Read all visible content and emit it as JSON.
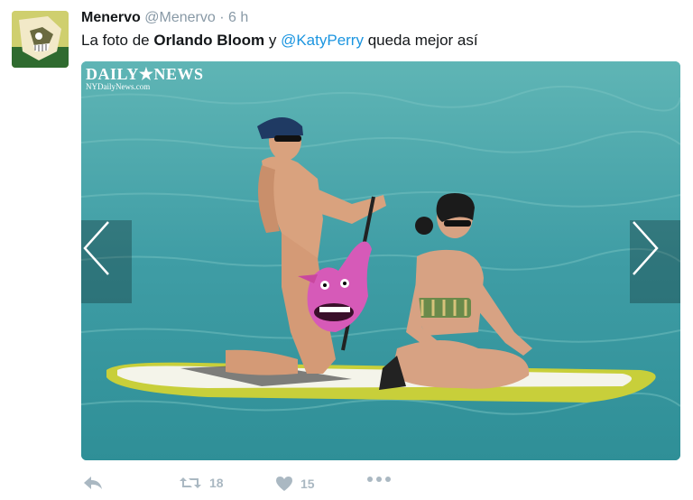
{
  "tweet": {
    "author_name": "Menervo",
    "author_handle": "@Menervo",
    "separator": "·",
    "time": "6 h",
    "text_part1": "La foto de ",
    "text_bold": "Orlando Bloom",
    "text_part2": " y ",
    "text_mention": "@KatyPerry",
    "text_part3": " queda mejor así"
  },
  "media": {
    "watermark_title": "DAILY★NEWS",
    "watermark_sub": "NYDailyNews.com",
    "prev_icon": "chevron-left-icon",
    "next_icon": "chevron-right-icon"
  },
  "actions": {
    "reply_icon": "reply-icon",
    "retweet_icon": "retweet-icon",
    "retweet_count": "18",
    "like_icon": "heart-icon",
    "like_count": "15",
    "more_icon": "more-icon"
  },
  "colors": {
    "link": "#1b95e0",
    "muted": "#8899a6",
    "action": "#aab8c2",
    "water": "#3f9fa6"
  }
}
